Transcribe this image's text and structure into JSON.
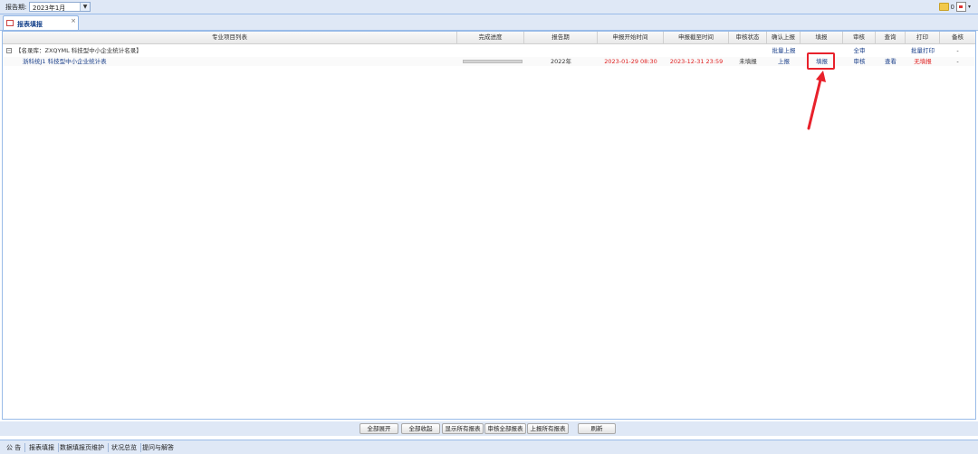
{
  "topbar": {
    "period_label": "报告期:",
    "period_value": "2023年1月",
    "right_icon_text": "0"
  },
  "tab": {
    "label": "报表填报",
    "close": "×"
  },
  "grid": {
    "columns": [
      "专业项目列表",
      "完成进度",
      "报告期",
      "申报开始时间",
      "申报截至时间",
      "审核状态",
      "确认上报",
      "填报",
      "审核",
      "查询",
      "打印",
      "备核"
    ],
    "group_row": {
      "title": "【名录库：ZXQYML 科技型中小企业统计名录】",
      "confirm": "批量上报",
      "review": "全审",
      "print": "批量打印",
      "extra": "-"
    },
    "data_row": {
      "name": "浙科统J1 科技型中小企业统计表",
      "period": "2022年",
      "start": "2023-01-29 08:30",
      "end": "2023-12-31 23:59",
      "status": "未填报",
      "confirm": "上报",
      "fill": "填报",
      "review": "审核",
      "query": "查看",
      "print": "无填报",
      "extra": "-",
      "progress": 0
    }
  },
  "buttons": [
    "全部展开",
    "全部收起",
    "显示所有报表",
    "审核全部报表",
    "上报所有报表",
    "刷新"
  ],
  "footer": [
    "公 告",
    "报表填报",
    "数据填报页维护",
    "状况总览",
    "提问与解答"
  ]
}
